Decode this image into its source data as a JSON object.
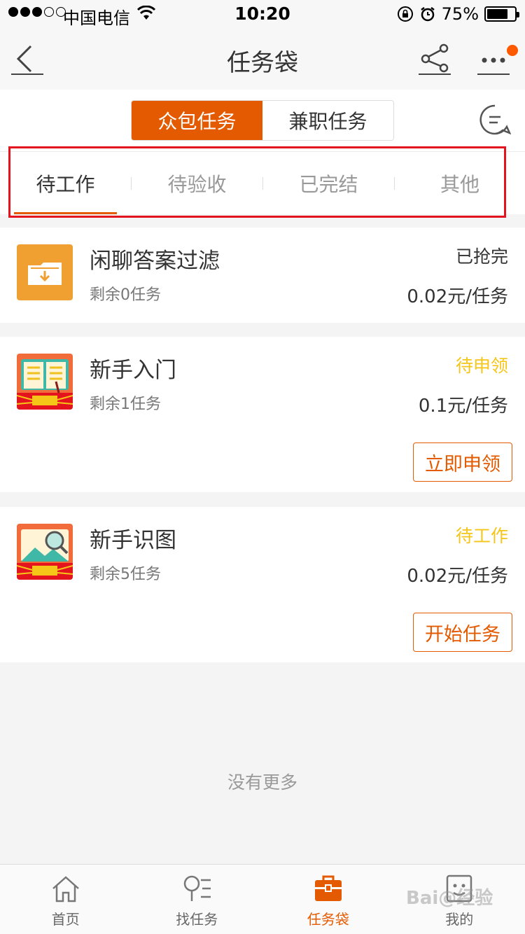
{
  "status_bar": {
    "carrier": "中国电信",
    "time": "10:20",
    "battery": "75%",
    "battery_level": 0.75
  },
  "nav": {
    "title": "任务袋",
    "badge_color": "#ff5a00"
  },
  "segment": {
    "items": [
      {
        "label": "众包任务",
        "active": true
      },
      {
        "label": "兼职任务",
        "active": false
      }
    ]
  },
  "tabs": {
    "items": [
      {
        "label": "待工作",
        "active": true
      },
      {
        "label": "待验收",
        "active": false
      },
      {
        "label": "已完结",
        "active": false
      },
      {
        "label": "其他",
        "active": false
      }
    ]
  },
  "tasks": [
    {
      "title": "闲聊答案过滤",
      "remaining": "剩余0任务",
      "status": "已抢完",
      "price": "0.02元/任务",
      "icon": "folder-download-icon"
    },
    {
      "title": "新手入门",
      "remaining": "剩余1任务",
      "status": "待申领",
      "price": "0.1元/任务",
      "button": "立即申领",
      "icon": "book-icon"
    },
    {
      "title": "新手识图",
      "remaining": "剩余5任务",
      "status": "待工作",
      "price": "0.02元/任务",
      "button": "开始任务",
      "icon": "image-search-icon"
    }
  ],
  "footer_text": "没有更多",
  "tabbar": {
    "items": [
      {
        "label": "首页",
        "icon": "home-icon",
        "active": false
      },
      {
        "label": "找任务",
        "icon": "search-list-icon",
        "active": false
      },
      {
        "label": "任务袋",
        "icon": "briefcase-icon",
        "active": true
      },
      {
        "label": "我的",
        "icon": "profile-icon",
        "active": false
      }
    ]
  },
  "watermark": "Bai@经验",
  "colors": {
    "accent": "#e35a00",
    "status_pending": "#f5c518",
    "highlight_border": "#e3141d"
  }
}
